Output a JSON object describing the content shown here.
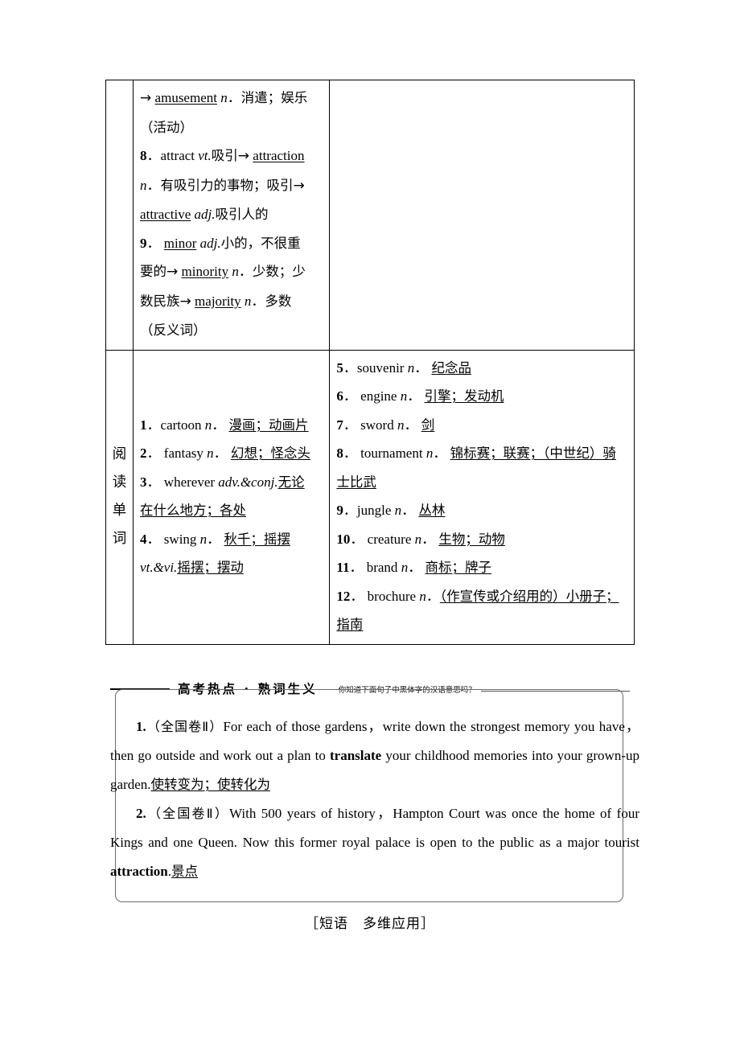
{
  "table": {
    "rows": [
      {
        "label": "",
        "left_entries": [
          "→ amusement n. 消遣；娱乐（活动）",
          "8. attract vt. 吸引→ attraction n. 有吸引力的事物；吸引→ attractive adj. 吸引人的",
          "9. minor adj. 小的，不很重要的→ minority n. 少数；少数民族→ majority n. 多数（反义词）"
        ],
        "right_entries": []
      },
      {
        "label": "阅读单词",
        "left_entries": [
          "1. cartoon n. 漫画；动画片",
          "2. fantasy n. 幻想；怪念头",
          "3. wherever adv.&conj. 无论在什么地方；各处",
          "4. swing n. 秋千；摇摆 vt.&vi. 摇摆；摆动"
        ],
        "right_entries": [
          "5. souvenir n. 纪念品",
          "6. engine n. 引擎；发动机",
          "7. sword n. 剑",
          "8. tournament n. 锦标赛；联赛；（中世纪）骑士比武",
          "9. jungle n. 丛林",
          "10. creature n. 生物；动物",
          "11. brand n. 商标；牌子",
          "12. brochure n. （作宣传或介绍用的）小册子；指南"
        ]
      }
    ],
    "row1": {
      "e1_arrow": "→",
      "e1_word": "amusement",
      "e1_pos": "n",
      "e1_def": "消遣；娱乐",
      "e1_def2": "（活动）",
      "e2_num": "8",
      "e2_word": "attract",
      "e2_pos": "vt.",
      "e2_def": "吸引",
      "e2_arrow": "→",
      "e2_word2": "attraction",
      "e2_pos2": "n",
      "e2_def2": "有吸引力的事物；吸引",
      "e2_arrow2": "→",
      "e2_word3": "attractive",
      "e2_pos3": "adj.",
      "e2_def3": "吸引人的",
      "e3_num": "9",
      "e3_word": "minor",
      "e3_pos": "adj.",
      "e3_def": "小的，不很重",
      "e3_def_cont": "要的",
      "e3_arrow": "→",
      "e3_word2": "minority",
      "e3_pos2": "n",
      "e3_def2": "少数；少",
      "e3_def2_cont": "数民族",
      "e3_arrow2": "→",
      "e3_word3": "majority",
      "e3_pos3": "n",
      "e3_def3": "多数",
      "e3_def4": "（反义词）"
    },
    "row2_label_chars": [
      "阅",
      "读",
      "单",
      "词"
    ],
    "row2_left": [
      {
        "num": "1",
        "word": "cartoon",
        "pos": "n",
        "def": "漫画；动画片"
      },
      {
        "num": "2",
        "word": "fantasy",
        "pos": "n",
        "def": "幻想；怪念头"
      },
      {
        "num": "3",
        "word": "wherever",
        "pos": "adv.&conj.",
        "def": "无论",
        "def_cont": "在什么地方；各处"
      },
      {
        "num": "4",
        "word": "swing",
        "pos": "n",
        "def": "秋千；摇摆",
        "pos2": "vt.&vi.",
        "def2": "摇摆；摆动"
      }
    ],
    "row2_right": [
      {
        "num": "5",
        "word": "souvenir",
        "pos": "n",
        "def": "纪念品"
      },
      {
        "num": "6",
        "word": "engine",
        "pos": "n",
        "def": "引擎；发动机"
      },
      {
        "num": "7",
        "word": "sword",
        "pos": "n",
        "def": "剑"
      },
      {
        "num": "8",
        "word": "tournament",
        "pos": "n",
        "def": "锦标赛；联赛；（中世纪）骑",
        "def_cont": "士比武"
      },
      {
        "num": "9",
        "word": "jungle",
        "pos": "n",
        "def": "丛林"
      },
      {
        "num": "10",
        "word": "creature",
        "pos": "n",
        "def": "生物；动物"
      },
      {
        "num": "11",
        "word": "brand",
        "pos": "n",
        "def": "商标；牌子"
      },
      {
        "num": "12",
        "word": "brochure",
        "pos": "n",
        "def": "（作宣传或介绍用的）小册子；",
        "def_cont": "指南"
      }
    ]
  },
  "banner": {
    "title": "高考热点 · 熟词生义",
    "subtitle": "你知道下面句子中黑体字的汉语意思吗？"
  },
  "examples": [
    {
      "num": "1.",
      "source": "（全国卷Ⅱ）",
      "text_before": "For each of those gardens，write down the strongest memory you have，then go outside and work out a plan to ",
      "keyword": "translate",
      "text_after": " your childhood memories into your grown-up garden.",
      "answer": "使转变为；使转化为"
    },
    {
      "num": "2.",
      "source": "（全国卷Ⅱ）",
      "text_before": "With 500 years of history，Hampton Court was once the home of four Kings and one Queen. Now this former royal palace is open to the public as a major tourist ",
      "keyword": "attraction",
      "text_after": ".",
      "answer": "景点"
    }
  ],
  "footer": {
    "section_title": "［短语　多维应用］"
  }
}
